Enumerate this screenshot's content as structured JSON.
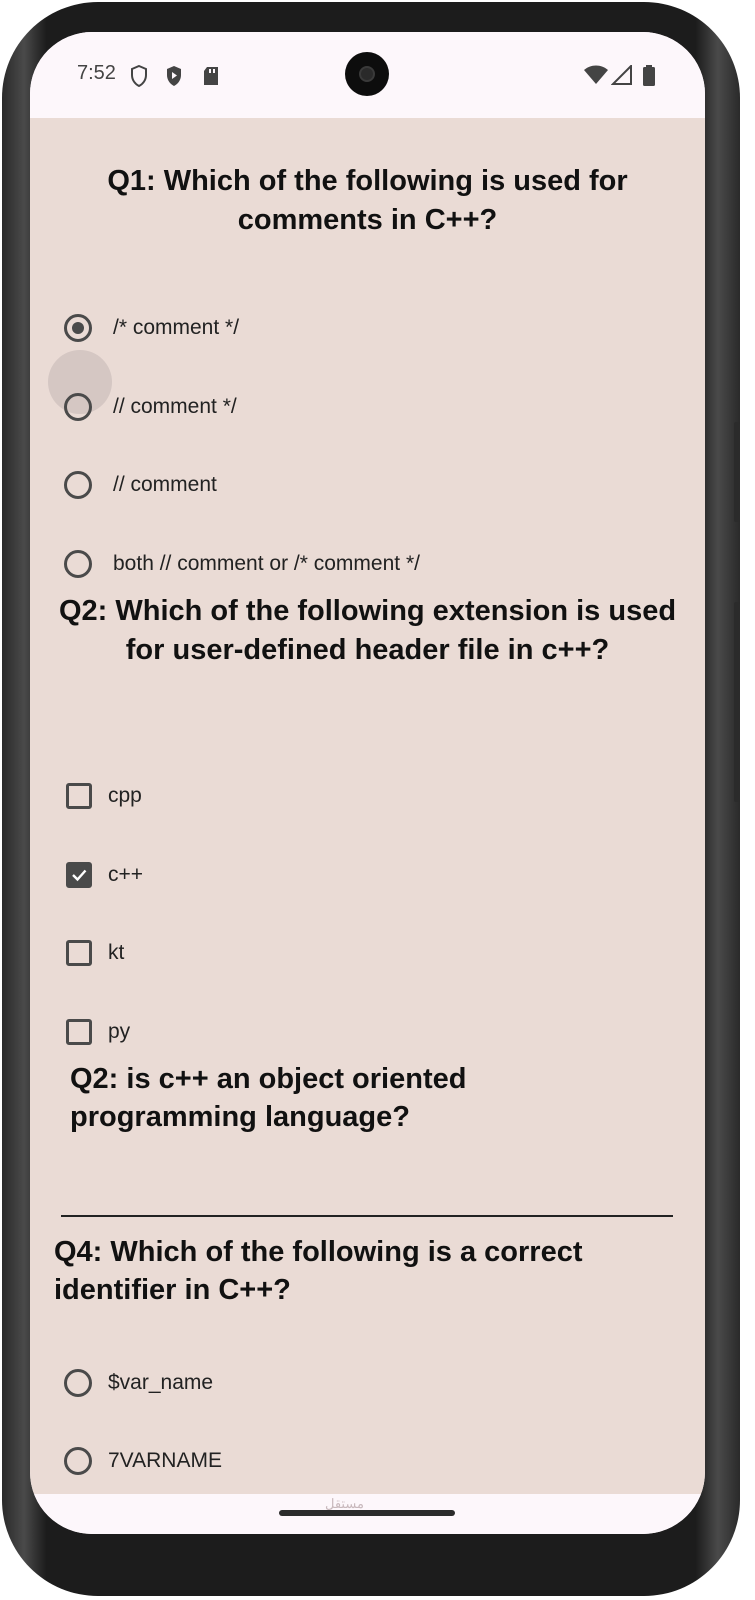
{
  "status_bar": {
    "time": "7:52",
    "left_icons": [
      "shield-outline-icon",
      "shield-play-icon",
      "sd-card-icon"
    ],
    "right_icons": [
      "wifi-icon",
      "cell-signal-icon",
      "battery-icon"
    ]
  },
  "questions": [
    {
      "title": "Q1: Which of the following is used for comments in C++?",
      "type": "radio",
      "options": [
        {
          "label": "/* comment */",
          "selected": true
        },
        {
          "label": "// comment */",
          "selected": false
        },
        {
          "label": "// comment",
          "selected": false
        },
        {
          "label": "both // comment or /* comment */",
          "selected": false
        }
      ]
    },
    {
      "title": "Q2: Which of the following extension is used for user-defined header file in c++?",
      "type": "checkbox",
      "options": [
        {
          "label": "cpp",
          "checked": false
        },
        {
          "label": "c++",
          "checked": true
        },
        {
          "label": "kt",
          "checked": false
        },
        {
          "label": "py",
          "checked": false
        }
      ]
    },
    {
      "title": "Q2: is c++ an object oriented programming language?",
      "type": "text"
    },
    {
      "title": "Q4: Which of the following is a correct identifier in C++?",
      "type": "radio",
      "options": [
        {
          "label": "$var_name",
          "selected": false
        },
        {
          "label": "7VARNAME",
          "selected": false
        }
      ]
    }
  ],
  "watermark": "مستقل",
  "colors": {
    "screen_background": "#eadbd5",
    "control": "#4a4a4a",
    "system_bar": "#fdf7fb"
  }
}
